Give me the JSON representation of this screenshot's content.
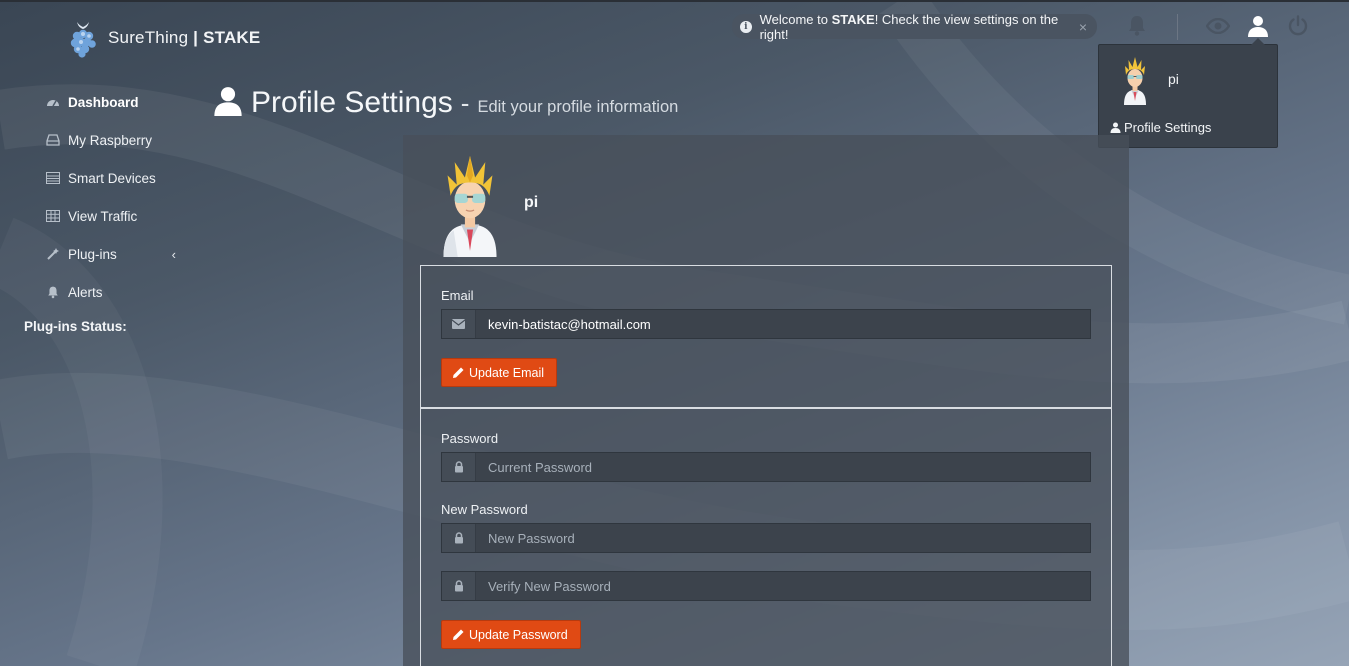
{
  "brand": {
    "name": "SureThing",
    "product": "STAKE",
    "separator": "|"
  },
  "notification": {
    "text_prefix": "Welcome to ",
    "text_bold": "STAKE",
    "text_suffix": "! Check the view settings on the right!",
    "close_symbol": "×"
  },
  "topbar": {
    "icons": [
      "bell-icon",
      "eye-icon",
      "user-icon",
      "power-icon"
    ]
  },
  "user_menu": {
    "username": "pi",
    "link_label": "Profile Settings"
  },
  "sidebar": {
    "items": [
      {
        "label": "Dashboard",
        "icon": "dashboard-icon",
        "active": true
      },
      {
        "label": "My Raspberry",
        "icon": "hdd-icon"
      },
      {
        "label": "Smart Devices",
        "icon": "list-icon"
      },
      {
        "label": "View Traffic",
        "icon": "table-icon"
      },
      {
        "label": "Plug-ins",
        "icon": "magic-icon",
        "chevron": "‹"
      },
      {
        "label": "Alerts",
        "icon": "bell-icon"
      }
    ],
    "plugins_status_label": "Plug-ins Status:"
  },
  "page": {
    "title": "Profile Settings",
    "separator": "-",
    "subtitle": "Edit your profile information"
  },
  "profile": {
    "username": "pi",
    "email_label": "Email",
    "email_value": "kevin-batistac@hotmail.com",
    "update_email_label": "Update Email",
    "password_label": "Password",
    "current_password_placeholder": "Current Password",
    "new_password_label": "New Password",
    "new_password_placeholder": "New Password",
    "verify_password_placeholder": "Verify New Password",
    "update_password_label": "Update Password"
  },
  "colors": {
    "accent": "#e04a14",
    "panel": "#48505a",
    "dropdown": "#3a424c"
  }
}
